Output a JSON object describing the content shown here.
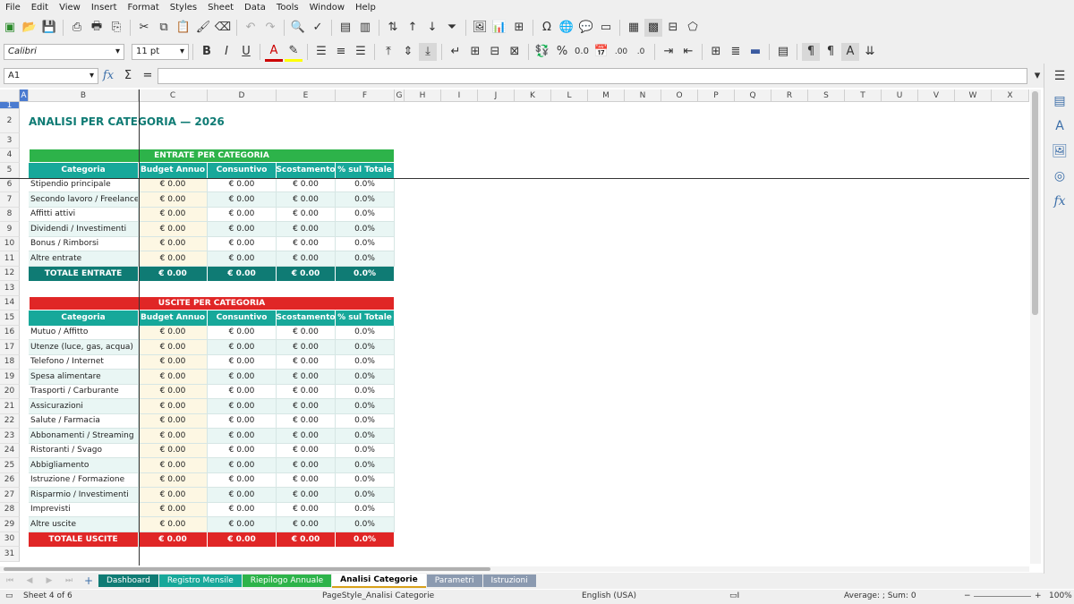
{
  "menu": [
    "File",
    "Edit",
    "View",
    "Insert",
    "Format",
    "Styles",
    "Sheet",
    "Data",
    "Tools",
    "Window",
    "Help"
  ],
  "toolbar": {
    "font_name": "Calibri",
    "font_size": "11 pt"
  },
  "formula": {
    "cell_ref": "A1",
    "fx": "fx",
    "sum": "Σ",
    "eq": "="
  },
  "columns": [
    "A",
    "B",
    "C",
    "D",
    "E",
    "F",
    "G",
    "H",
    "I",
    "J",
    "K",
    "L",
    "M",
    "N",
    "O",
    "P",
    "Q",
    "R",
    "S",
    "T",
    "U",
    "V",
    "W",
    "X"
  ],
  "rows": [
    "1",
    "2",
    "3",
    "4",
    "5",
    "6",
    "7",
    "8",
    "9",
    "10",
    "11",
    "12",
    "13",
    "14",
    "15",
    "16",
    "17",
    "18",
    "19",
    "20",
    "21",
    "22",
    "23",
    "24",
    "25",
    "26",
    "27",
    "28",
    "29",
    "30",
    "31"
  ],
  "title": "ANALISI PER CATEGORIA — 2026",
  "income": {
    "header": "ENTRATE PER CATEGORIA",
    "cols": [
      "Categoria",
      "Budget Annuo",
      "Consuntivo",
      "Scostamento",
      "% sul Totale"
    ],
    "rows": [
      {
        "cat": "Stipendio principale",
        "b": "€ 0.00",
        "c": "€ 0.00",
        "s": "€ 0.00",
        "p": "0.0%"
      },
      {
        "cat": "Secondo lavoro / Freelance",
        "b": "€ 0.00",
        "c": "€ 0.00",
        "s": "€ 0.00",
        "p": "0.0%"
      },
      {
        "cat": "Affitti attivi",
        "b": "€ 0.00",
        "c": "€ 0.00",
        "s": "€ 0.00",
        "p": "0.0%"
      },
      {
        "cat": "Dividendi / Investimenti",
        "b": "€ 0.00",
        "c": "€ 0.00",
        "s": "€ 0.00",
        "p": "0.0%"
      },
      {
        "cat": "Bonus / Rimborsi",
        "b": "€ 0.00",
        "c": "€ 0.00",
        "s": "€ 0.00",
        "p": "0.0%"
      },
      {
        "cat": "Altre entrate",
        "b": "€ 0.00",
        "c": "€ 0.00",
        "s": "€ 0.00",
        "p": "0.0%"
      }
    ],
    "total": {
      "cat": "TOTALE ENTRATE",
      "b": "€ 0.00",
      "c": "€ 0.00",
      "s": "€ 0.00",
      "p": "0.0%"
    }
  },
  "expense": {
    "header": "USCITE PER CATEGORIA",
    "cols": [
      "Categoria",
      "Budget Annuo",
      "Consuntivo",
      "Scostamento",
      "% sul Totale"
    ],
    "rows": [
      {
        "cat": "Mutuo / Affitto",
        "b": "€ 0.00",
        "c": "€ 0.00",
        "s": "€ 0.00",
        "p": "0.0%"
      },
      {
        "cat": "Utenze (luce, gas, acqua)",
        "b": "€ 0.00",
        "c": "€ 0.00",
        "s": "€ 0.00",
        "p": "0.0%"
      },
      {
        "cat": "Telefono / Internet",
        "b": "€ 0.00",
        "c": "€ 0.00",
        "s": "€ 0.00",
        "p": "0.0%"
      },
      {
        "cat": "Spesa alimentare",
        "b": "€ 0.00",
        "c": "€ 0.00",
        "s": "€ 0.00",
        "p": "0.0%"
      },
      {
        "cat": "Trasporti / Carburante",
        "b": "€ 0.00",
        "c": "€ 0.00",
        "s": "€ 0.00",
        "p": "0.0%"
      },
      {
        "cat": "Assicurazioni",
        "b": "€ 0.00",
        "c": "€ 0.00",
        "s": "€ 0.00",
        "p": "0.0%"
      },
      {
        "cat": "Salute / Farmacia",
        "b": "€ 0.00",
        "c": "€ 0.00",
        "s": "€ 0.00",
        "p": "0.0%"
      },
      {
        "cat": "Abbonamenti / Streaming",
        "b": "€ 0.00",
        "c": "€ 0.00",
        "s": "€ 0.00",
        "p": "0.0%"
      },
      {
        "cat": "Ristoranti / Svago",
        "b": "€ 0.00",
        "c": "€ 0.00",
        "s": "€ 0.00",
        "p": "0.0%"
      },
      {
        "cat": "Abbigliamento",
        "b": "€ 0.00",
        "c": "€ 0.00",
        "s": "€ 0.00",
        "p": "0.0%"
      },
      {
        "cat": "Istruzione / Formazione",
        "b": "€ 0.00",
        "c": "€ 0.00",
        "s": "€ 0.00",
        "p": "0.0%"
      },
      {
        "cat": "Risparmio / Investimenti",
        "b": "€ 0.00",
        "c": "€ 0.00",
        "s": "€ 0.00",
        "p": "0.0%"
      },
      {
        "cat": "Imprevisti",
        "b": "€ 0.00",
        "c": "€ 0.00",
        "s": "€ 0.00",
        "p": "0.0%"
      },
      {
        "cat": "Altre uscite",
        "b": "€ 0.00",
        "c": "€ 0.00",
        "s": "€ 0.00",
        "p": "0.0%"
      }
    ],
    "total": {
      "cat": "TOTALE USCITE",
      "b": "€ 0.00",
      "c": "€ 0.00",
      "s": "€ 0.00",
      "p": "0.0%"
    }
  },
  "sheet_tabs": [
    {
      "label": "Dashboard",
      "color": "#0f7b74",
      "text": "#ffffff"
    },
    {
      "label": "Registro Mensile",
      "color": "#17a89a",
      "text": "#ffffff"
    },
    {
      "label": "Riepilogo Annuale",
      "color": "#2db34a",
      "text": "#ffffff"
    },
    {
      "label": "Analisi Categorie",
      "color": "#ffffff",
      "text": "#000000",
      "active": true
    },
    {
      "label": "Parametri",
      "color": "#8b9ab0",
      "text": "#ffffff"
    },
    {
      "label": "Istruzioni",
      "color": "#8b9ab0",
      "text": "#ffffff"
    }
  ],
  "status": {
    "sheet": "Sheet 4 of 6",
    "page_style": "PageStyle_Analisi Categorie",
    "language": "English (USA)",
    "agg": "Average: ; Sum: 0",
    "zoom": "100%"
  },
  "colors": {
    "teal": "#17a89a",
    "dark_teal": "#0f7b74",
    "green": "#2db34a",
    "red": "#e02626",
    "title": "#0f7b74"
  }
}
